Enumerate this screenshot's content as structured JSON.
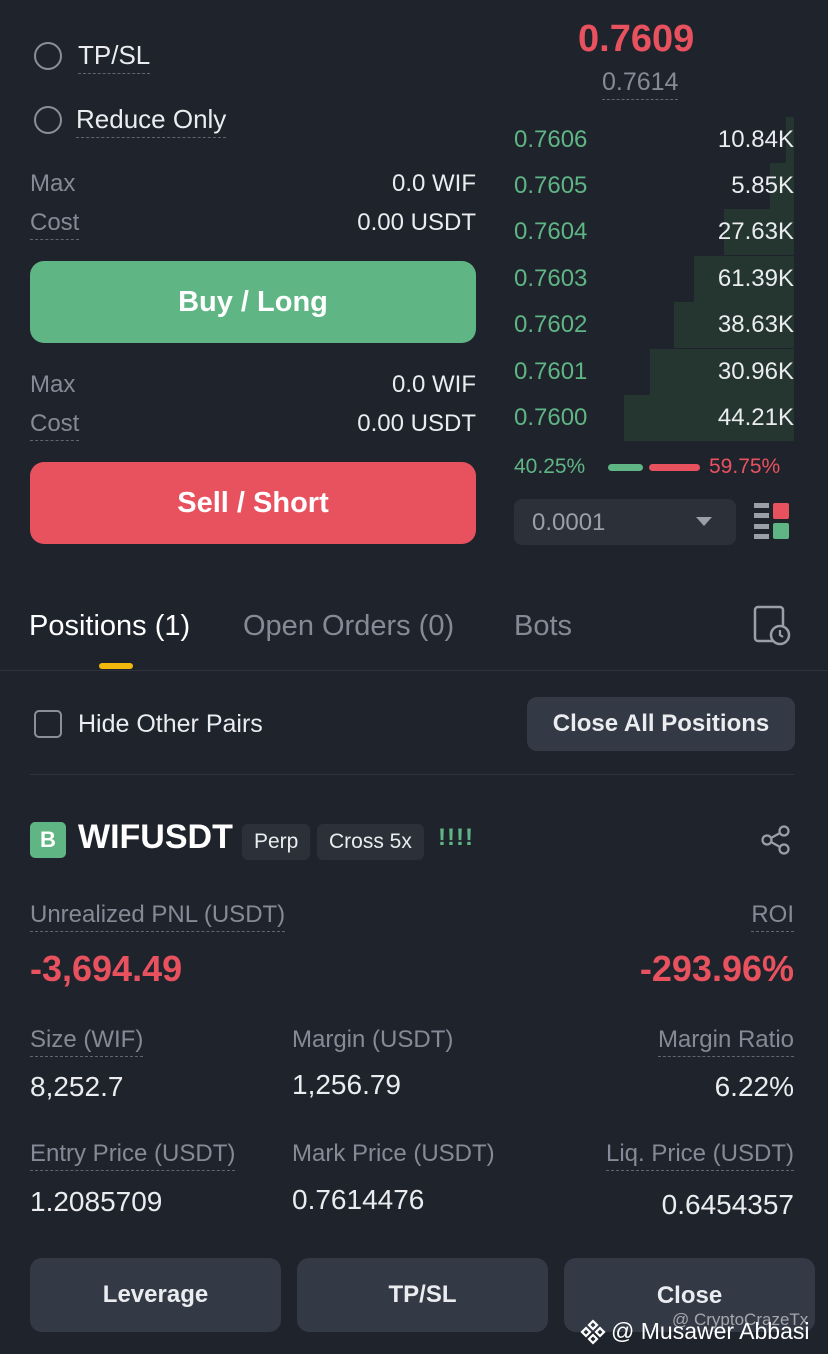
{
  "order_form": {
    "tpsl_label": "TP/SL",
    "reduce_only_label": "Reduce Only",
    "buy": {
      "max_label": "Max",
      "max_value": "0.0 WIF",
      "cost_label": "Cost",
      "cost_value": "0.00 USDT",
      "button_label": "Buy / Long",
      "color": "#5fb584"
    },
    "sell": {
      "max_label": "Max",
      "max_value": "0.0 WIF",
      "cost_label": "Cost",
      "cost_value": "0.00 USDT",
      "button_label": "Sell / Short",
      "color": "#e8525f"
    }
  },
  "order_book": {
    "last_price": "0.7609",
    "mark_price": "0.7614",
    "bids": [
      {
        "price": "0.7606",
        "qty": "10.84K",
        "depth": 0.04
      },
      {
        "price": "0.7605",
        "qty": "5.85K",
        "depth": 0.12
      },
      {
        "price": "0.7604",
        "qty": "27.63K",
        "depth": 0.35
      },
      {
        "price": "0.7603",
        "qty": "61.39K",
        "depth": 0.5
      },
      {
        "price": "0.7602",
        "qty": "38.63K",
        "depth": 0.6
      },
      {
        "price": "0.7601",
        "qty": "30.96K",
        "depth": 0.72
      },
      {
        "price": "0.7600",
        "qty": "44.21K",
        "depth": 0.85
      }
    ],
    "buy_ratio": "40.25%",
    "sell_ratio": "59.75%",
    "buy_fraction": 0.4025,
    "precision_value": "0.0001",
    "precision_icon": "chevron-down-icon",
    "layout_icon": "orderbook-layout-icon"
  },
  "tabs": {
    "positions": "Positions (1)",
    "open_orders": "Open Orders (0)",
    "bots": "Bots",
    "history_icon": "history-icon"
  },
  "filters": {
    "hide_other_pairs": "Hide Other Pairs",
    "close_all": "Close All Positions"
  },
  "position": {
    "badge": "B",
    "symbol": "WIFUSDT",
    "type_chip": "Perp",
    "margin_chip": "Cross 5x",
    "risk_indicator": "!!!!",
    "share_icon": "share-icon",
    "pnl_label": "Unrealized PNL (USDT)",
    "pnl_value": "-3,694.49",
    "roi_label": "ROI",
    "roi_value": "-293.96%",
    "size_label": "Size (WIF)",
    "size_value": "8,252.7",
    "margin_label": "Margin (USDT)",
    "margin_value": "1,256.79",
    "margin_ratio_label": "Margin Ratio",
    "margin_ratio_value": "6.22%",
    "entry_label": "Entry Price (USDT)",
    "entry_value": "1.2085709",
    "mark_label": "Mark Price (USDT)",
    "mark_value": "0.7614476",
    "liq_label": "Liq. Price (USDT)",
    "liq_value": "0.6454357"
  },
  "actions": {
    "leverage": "Leverage",
    "tpsl": "TP/SL",
    "close": "Close"
  },
  "watermark": {
    "line1": "@ CryptoCrazeTx",
    "line2": "@ Musawer Abbasi"
  }
}
